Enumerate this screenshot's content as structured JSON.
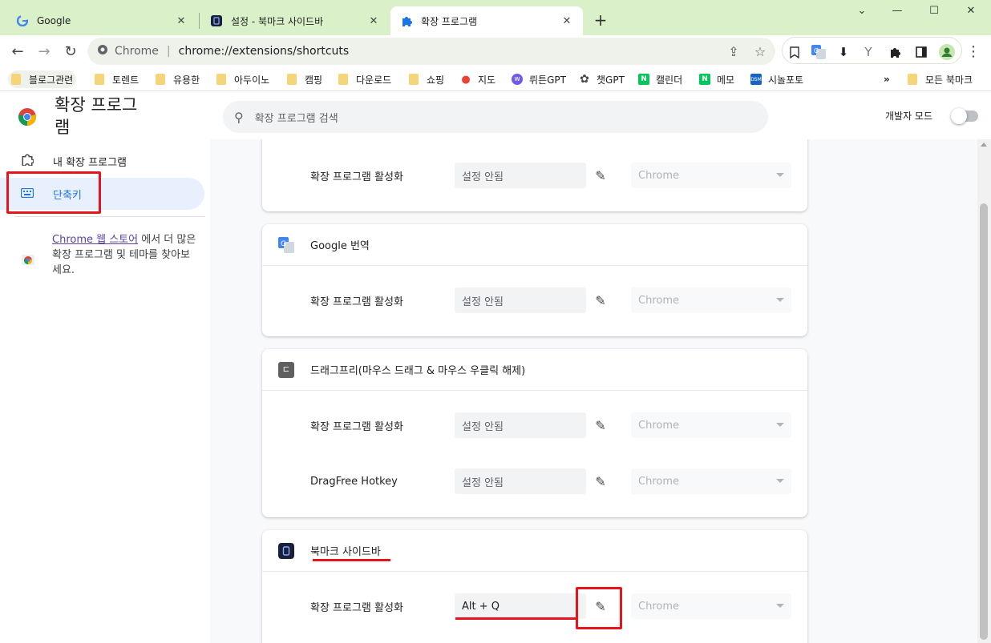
{
  "tabs": [
    {
      "title": "Google",
      "icon": "google-icon",
      "active": false
    },
    {
      "title": "설정 - 북마크 사이드바",
      "icon": "bookmark-sidebar-icon",
      "active": false
    },
    {
      "title": "확장 프로그램",
      "icon": "puzzle-icon",
      "active": true
    }
  ],
  "address": {
    "site": "Chrome",
    "url": "chrome://extensions/shortcuts"
  },
  "bookmarks": [
    {
      "label": "블로그관련",
      "icon": "folder-icon"
    },
    {
      "label": "토렌트",
      "icon": "folder-icon"
    },
    {
      "label": "유용한",
      "icon": "folder-icon"
    },
    {
      "label": "아두이노",
      "icon": "folder-icon"
    },
    {
      "label": "캠핑",
      "icon": "folder-icon"
    },
    {
      "label": "다운로드",
      "icon": "folder-icon"
    },
    {
      "label": "쇼핑",
      "icon": "folder-icon"
    },
    {
      "label": "지도",
      "icon": "maps-icon"
    },
    {
      "label": "뤼튼GPT",
      "icon": "wrtn-icon"
    },
    {
      "label": "챗GPT",
      "icon": "chatgpt-icon"
    },
    {
      "label": "캘린더",
      "icon": "naver-icon"
    },
    {
      "label": "메모",
      "icon": "naver-icon"
    },
    {
      "label": "시놀포토",
      "icon": "dsm-icon"
    }
  ],
  "bookmarks_more": "»",
  "other_bookmarks": "모든 북마크",
  "header": {
    "title": "확장 프로그램",
    "search_placeholder": "확장 프로그램 검색",
    "devmode_label": "개발자 모드"
  },
  "sidebar": {
    "items": [
      {
        "label": "내 확장 프로그램",
        "icon": "puzzle-outline-icon"
      },
      {
        "label": "단축키",
        "icon": "keyboard-icon",
        "selected": true
      }
    ],
    "store_link": "Chrome 웹 스토어",
    "store_text": "에서 더 많은 확장 프로그램 및 테마를 찾아보세요."
  },
  "cards": [
    {
      "name": "",
      "rows": [
        {
          "label": "확장 프로그램 활성화",
          "shortcut": "설정 안됨",
          "scope": "Chrome"
        }
      ]
    },
    {
      "name": "Google 번역",
      "icon": "google-translate-icon",
      "rows": [
        {
          "label": "확장 프로그램 활성화",
          "shortcut": "설정 안됨",
          "scope": "Chrome"
        }
      ]
    },
    {
      "name": "드래그프리(마우스 드래그 & 마우스 우클릭 해제)",
      "icon": "dragfree-icon",
      "rows": [
        {
          "label": "확장 프로그램 활성화",
          "shortcut": "설정 안됨",
          "scope": "Chrome"
        },
        {
          "label": "DragFree Hotkey",
          "shortcut": "설정 안됨",
          "scope": "Chrome"
        }
      ]
    },
    {
      "name": "북마크 사이드바",
      "icon": "bookmark-sidebar-icon",
      "rows": [
        {
          "label": "확장 프로그램 활성화",
          "shortcut": "Alt + Q",
          "scope": "Chrome"
        }
      ]
    }
  ],
  "colors": {
    "accent": "#1a73e8",
    "annotation": "#e8141c",
    "tabstrip": "#d9f0c8"
  }
}
